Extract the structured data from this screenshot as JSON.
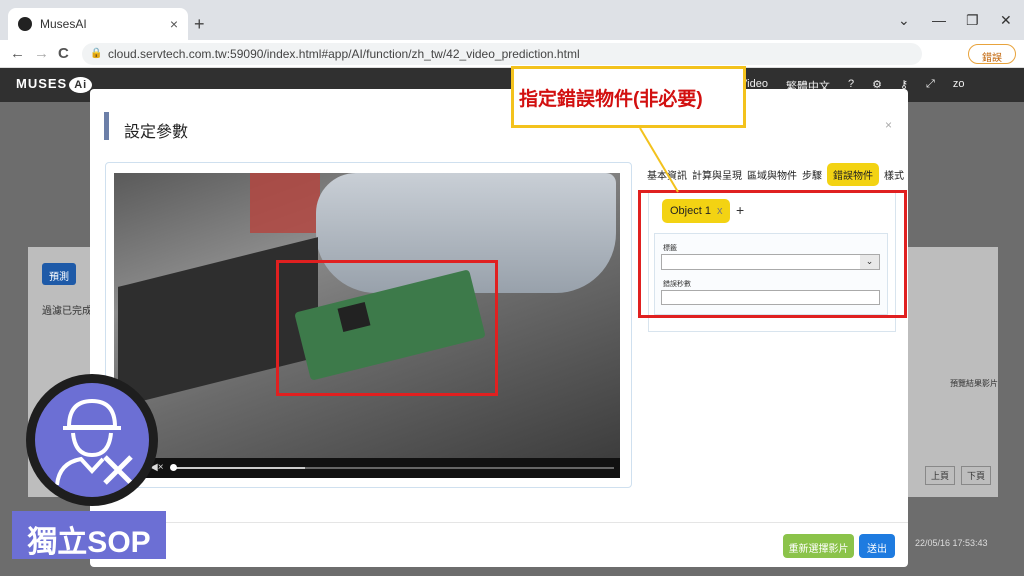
{
  "browser": {
    "tab_title": "MusesAI",
    "tab_close": "×",
    "new_tab": "+",
    "url": "cloud.servtech.com.tw:59090/index.html#app/AI/function/zh_tw/42_video_prediction.html",
    "update_label": "錯誤",
    "back": "←",
    "forward": "→",
    "reload": "C",
    "minimize": "—",
    "restore": "❐",
    "close": "✕",
    "tab_list": "⌄"
  },
  "app": {
    "logo_text": "MUSES",
    "logo_badge": "Ai",
    "nav_video": "Video",
    "nav_lang": "繁體中文",
    "nav_user": "zo"
  },
  "background_page": {
    "predict_button": "預測",
    "status_text": "過濾已完成",
    "column_label": "預覽結果影片",
    "prev_page": "上頁",
    "next_page": "下頁",
    "timestamp": "22/05/16 17:53:43"
  },
  "modal": {
    "title": "設定參數",
    "close": "×",
    "tabs": [
      "基本資訊",
      "計算與呈現",
      "區域與物件",
      "步驟",
      "錯誤物件",
      "樣式"
    ],
    "active_tab": "錯誤物件",
    "object_tag": "Object 1",
    "object_tag_remove": "x",
    "add_object": "+",
    "field_label_1": "標籤",
    "select_arrow": "⌄",
    "field_label_2": "錯誤秒數",
    "reselect_button": "重新選擇影片",
    "send_button": "送出"
  },
  "video": {
    "mute_icon": "◀×",
    "progress": 0.3
  },
  "annotation": {
    "callout_text": "指定錯誤物件(非必要)"
  },
  "overlay": {
    "sop_label": "獨立SOP"
  },
  "colors": {
    "highlight_red": "#e02020",
    "callout_yellow": "#f3c21d",
    "active_tab_yellow": "#f3d313",
    "badge_purple": "#6c6fd4",
    "green_button": "#8bc34a",
    "blue_button": "#1e7be0"
  }
}
